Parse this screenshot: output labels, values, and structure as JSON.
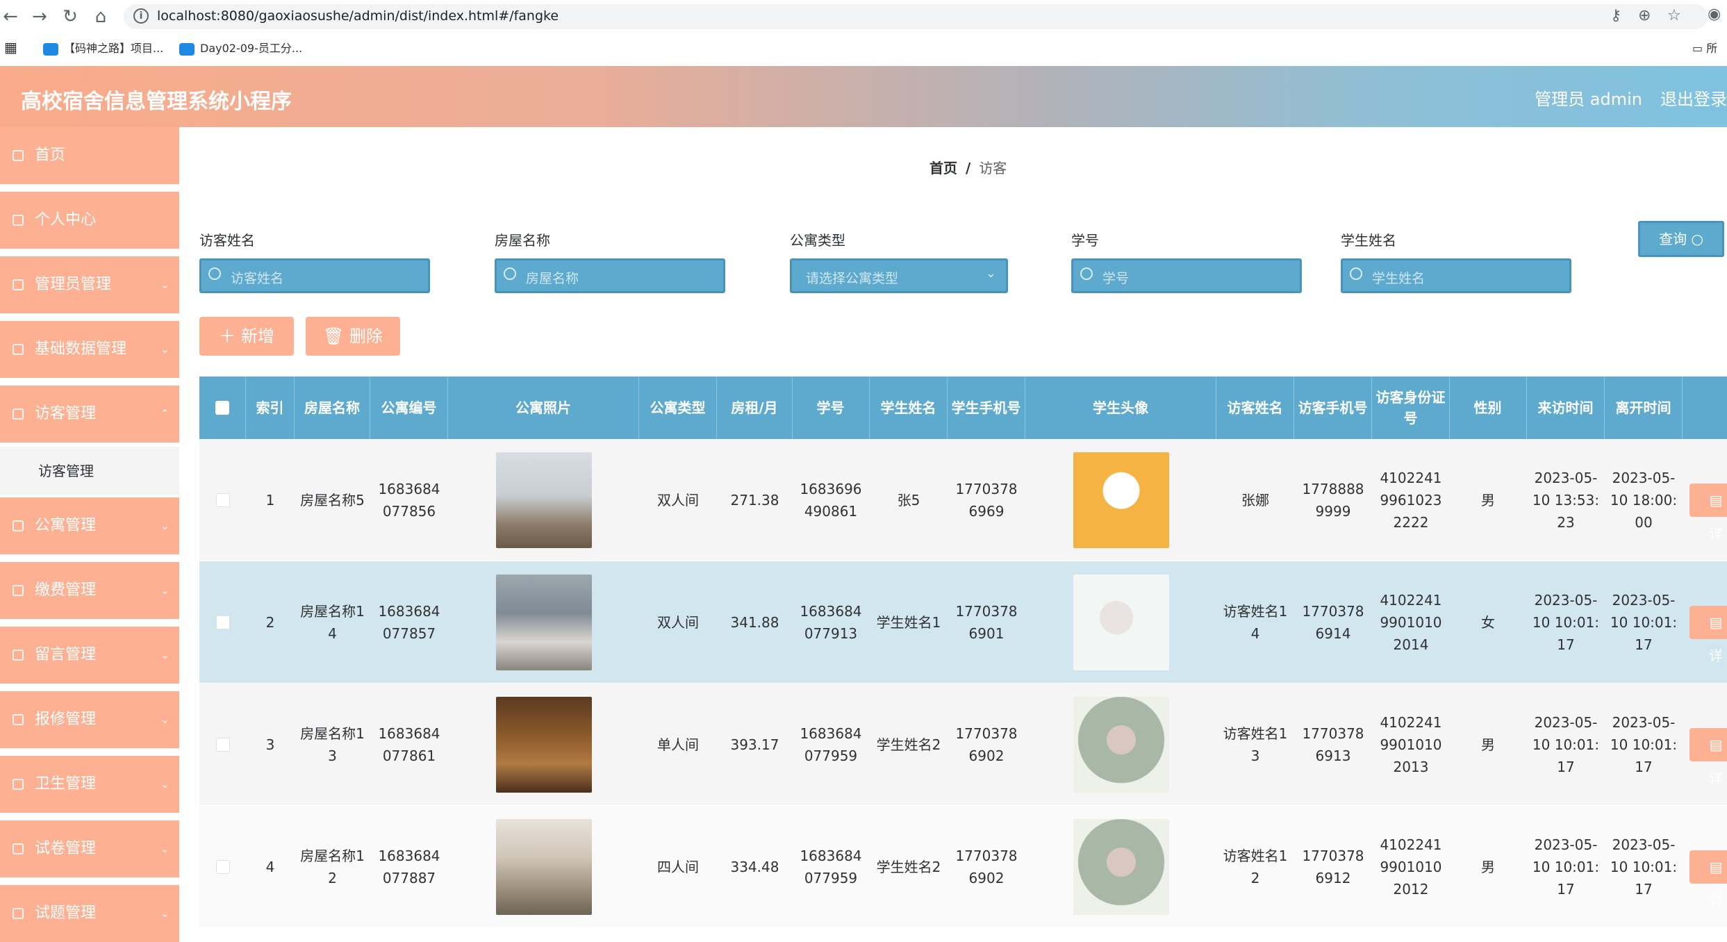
{
  "browser": {
    "url": "localhost:8080/gaoxiaosushe/admin/dist/index.html#/fangke",
    "bookmarks": [
      "【码神之路】项目...",
      "Day02-09-员工分..."
    ],
    "bookmarks_right": "所"
  },
  "header": {
    "title": "高校宿舍信息管理系统小程序",
    "admin_label": "管理员 admin",
    "logout_label": "退出登录"
  },
  "sidebar": {
    "items": [
      {
        "label": "首页"
      },
      {
        "label": "个人中心"
      },
      {
        "label": "管理员管理"
      },
      {
        "label": "基础数据管理"
      },
      {
        "label": "访客管理"
      },
      {
        "label": "公寓管理"
      },
      {
        "label": "缴费管理"
      },
      {
        "label": "留言管理"
      },
      {
        "label": "报修管理"
      },
      {
        "label": "卫生管理"
      },
      {
        "label": "试卷管理"
      },
      {
        "label": "试题管理"
      }
    ],
    "sub_item": "访客管理"
  },
  "breadcrumb": {
    "home": "首页",
    "separator": "/",
    "current": "访客"
  },
  "filters": [
    {
      "label": "访客姓名",
      "placeholder": "访客姓名"
    },
    {
      "label": "房屋名称",
      "placeholder": "房屋名称"
    },
    {
      "label": "公寓类型",
      "placeholder": "请选择公寓类型"
    },
    {
      "label": "学号",
      "placeholder": "学号"
    },
    {
      "label": "学生姓名",
      "placeholder": "学生姓名"
    }
  ],
  "buttons": {
    "query": "查询",
    "add": "新增",
    "delete": "删除",
    "row_action": "详"
  },
  "table": {
    "headers": [
      "索引",
      "房屋名称",
      "公寓编号",
      "公寓照片",
      "公寓类型",
      "房租/月",
      "学号",
      "学生姓名",
      "学生手机号",
      "学生头像",
      "访客姓名",
      "访客手机号",
      "访客身份证号",
      "性别",
      "来访时间",
      "离开时间"
    ],
    "rows": [
      {
        "index": "1",
        "house": "房屋名称5",
        "code": "1683684077856",
        "type": "双人间",
        "rent": "271.38",
        "student_no": "1683696490861",
        "student": "张5",
        "phone": "17703786969",
        "visitor": "张娜",
        "visitor_phone": "17788889999",
        "idcard": "410224199610232222",
        "gender": "男",
        "visit_time": "2023-05-10 13:53:23",
        "leave_time": "2023-05-10 18:00:00"
      },
      {
        "index": "2",
        "house": "房屋名称14",
        "code": "1683684077857",
        "type": "双人间",
        "rent": "341.88",
        "student_no": "1683684077913",
        "student": "学生姓名1",
        "phone": "17703786901",
        "visitor": "访客姓名14",
        "visitor_phone": "17703786914",
        "idcard": "410224199010102014",
        "gender": "女",
        "visit_time": "2023-05-10 10:01:17",
        "leave_time": "2023-05-10 10:01:17"
      },
      {
        "index": "3",
        "house": "房屋名称13",
        "code": "1683684077861",
        "type": "单人间",
        "rent": "393.17",
        "student_no": "1683684077959",
        "student": "学生姓名2",
        "phone": "17703786902",
        "visitor": "访客姓名13",
        "visitor_phone": "17703786913",
        "idcard": "410224199010102013",
        "gender": "男",
        "visit_time": "2023-05-10 10:01:17",
        "leave_time": "2023-05-10 10:01:17"
      },
      {
        "index": "4",
        "house": "房屋名称12",
        "code": "1683684077887",
        "type": "四人间",
        "rent": "334.48",
        "student_no": "1683684077959",
        "student": "学生姓名2",
        "phone": "17703786902",
        "visitor": "访客姓名12",
        "visitor_phone": "17703786912",
        "idcard": "410224199010102012",
        "gender": "男",
        "visit_time": "2023-05-10 10:01:17",
        "leave_time": "2023-05-10 10:01:17"
      }
    ]
  },
  "colors": {
    "header_left": "#fbab8a",
    "header_right": "#7ec2e0",
    "sidebar": "#fdb092",
    "table_header": "#5eaacf",
    "input": "#5eaacf"
  }
}
